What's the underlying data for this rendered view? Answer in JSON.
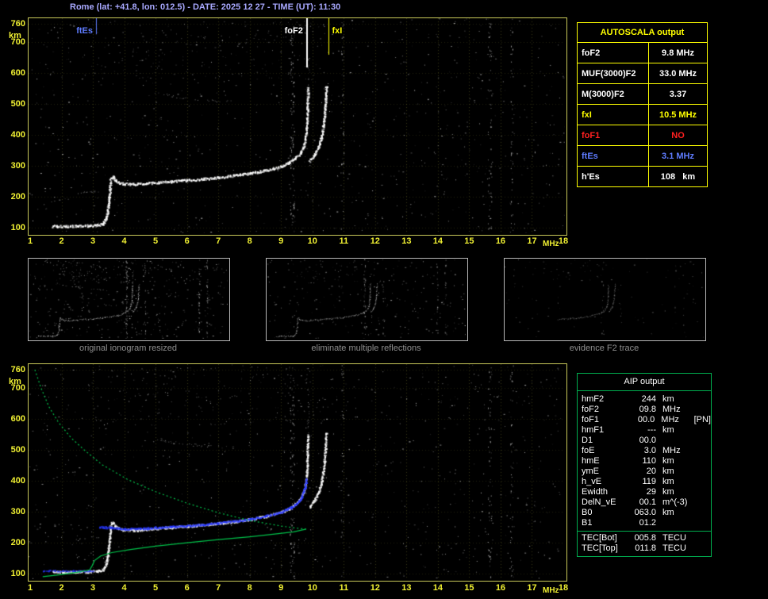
{
  "window": {
    "title": "Rome (lat: +41.8, lon: 012.5) - DATE: 2025 12 27 - TIME (UT): 11:30"
  },
  "autoscala": {
    "header": "AUTOSCALA output",
    "rows": [
      {
        "label": "foF2",
        "value": "9.8 MHz",
        "color": "#ffffff"
      },
      {
        "label": "MUF(3000)F2",
        "value": "33.0 MHz",
        "color": "#ffffff"
      },
      {
        "label": "M(3000)F2",
        "value": "3.37",
        "color": "#ffffff"
      },
      {
        "label": "fxI",
        "value": "10.5 MHz",
        "color": "#ffff00"
      },
      {
        "label": "foF1",
        "value": "NO",
        "color": "#ff2020"
      },
      {
        "label": "ftEs",
        "value": "3.1 MHz",
        "color": "#5f7cff"
      },
      {
        "label": "h'Es",
        "value": "108   km",
        "color": "#ffffff"
      }
    ]
  },
  "aip": {
    "header": "AIP output",
    "rows": [
      {
        "label": "hmF2",
        "value": "244",
        "unit": "km",
        "note": ""
      },
      {
        "label": "foF2",
        "value": "09.8",
        "unit": "MHz",
        "note": ""
      },
      {
        "label": "foF1",
        "value": "00.0",
        "unit": "MHz",
        "note": "[PN]"
      },
      {
        "label": "hmF1",
        "value": "---",
        "unit": "km",
        "note": ""
      },
      {
        "label": "D1",
        "value": "00.0",
        "unit": "",
        "note": ""
      },
      {
        "label": "foE",
        "value": "3.0",
        "unit": "MHz",
        "note": ""
      },
      {
        "label": "hmE",
        "value": "110",
        "unit": "km",
        "note": ""
      },
      {
        "label": "ymE",
        "value": "20",
        "unit": "km",
        "note": ""
      },
      {
        "label": "h_vE",
        "value": "119",
        "unit": "km",
        "note": ""
      },
      {
        "label": "Ewidth",
        "value": "29",
        "unit": "km",
        "note": ""
      },
      {
        "label": "DelN_vE",
        "value": "00.1",
        "unit": "m^(-3)",
        "note": ""
      },
      {
        "label": "B0",
        "value": "063.0",
        "unit": "km",
        "note": ""
      },
      {
        "label": "B1",
        "value": "01.2",
        "unit": "",
        "note": ""
      }
    ],
    "tec_rows": [
      {
        "label": "TEC[Bot]",
        "value": "005.8",
        "unit": "TECU",
        "note": ""
      },
      {
        "label": "TEC[Top]",
        "value": "011.8",
        "unit": "TECU",
        "note": ""
      }
    ]
  },
  "thumbnails": [
    {
      "caption": "original ionogram resized",
      "mode": "full"
    },
    {
      "caption": "eliminate multiple reflections",
      "mode": "clean"
    },
    {
      "caption": "evidence F2 trace",
      "mode": "f2"
    }
  ],
  "chart_data": [
    {
      "type": "scatter",
      "id": "ionogram-top",
      "title": "ionogram with autoscaled characteristics",
      "xlabel": "MHz",
      "ylabel": "km",
      "xlim": [
        1,
        18
      ],
      "ylim": [
        82,
        778
      ],
      "x_ticks": [
        1,
        2,
        3,
        4,
        5,
        6,
        7,
        8,
        9,
        10,
        11,
        12,
        13,
        14,
        15,
        16,
        17,
        18
      ],
      "y_ticks": [
        760,
        700,
        600,
        500,
        400,
        300,
        200,
        100
      ],
      "grid": "dotted",
      "markers": [
        {
          "label": "ftEs",
          "freq": 3.1,
          "color": "#5f7cff",
          "len": 20,
          "width": 1,
          "side": "left"
        },
        {
          "label": "foF2",
          "freq": 9.8,
          "color": "#ffffff",
          "len": 62,
          "width": 2,
          "side": "left"
        },
        {
          "label": "fxI",
          "freq": 10.5,
          "color": "#ffff00",
          "len": 46,
          "width": 1,
          "side": "right"
        }
      ],
      "series": [
        {
          "name": "Es-trace",
          "points": [
            [
              1.7,
              106
            ],
            [
              2.1,
              106
            ],
            [
              2.5,
              107
            ],
            [
              2.9,
              108
            ],
            [
              3.15,
              110
            ],
            [
              3.3,
              114
            ],
            [
              3.4,
              128
            ],
            [
              3.46,
              155
            ],
            [
              3.5,
              190
            ],
            [
              3.53,
              222
            ],
            [
              3.55,
              250
            ]
          ]
        },
        {
          "name": "Es-second-hop",
          "sparse": true,
          "points": [
            [
              2.4,
              214
            ],
            [
              2.7,
              216
            ],
            [
              3.0,
              217
            ],
            [
              3.2,
              219
            ]
          ]
        },
        {
          "name": "F-ordinary",
          "points": [
            [
              3.55,
              258
            ],
            [
              3.62,
              267
            ],
            [
              3.7,
              256
            ],
            [
              3.82,
              247
            ],
            [
              4.0,
              243
            ],
            [
              4.3,
              242
            ],
            [
              4.7,
              245
            ],
            [
              5.1,
              248
            ],
            [
              5.5,
              251
            ],
            [
              6.0,
              255
            ],
            [
              6.5,
              259
            ],
            [
              7.0,
              264
            ],
            [
              7.5,
              270
            ],
            [
              8.0,
              277
            ],
            [
              8.5,
              287
            ],
            [
              9.0,
              300
            ],
            [
              9.25,
              312
            ],
            [
              9.45,
              326
            ],
            [
              9.6,
              343
            ],
            [
              9.7,
              363
            ],
            [
              9.76,
              388
            ],
            [
              9.8,
              418
            ],
            [
              9.82,
              452
            ],
            [
              9.83,
              488
            ],
            [
              9.84,
              522
            ],
            [
              9.85,
              552
            ]
          ]
        },
        {
          "name": "F-extraordinary",
          "points": [
            [
              9.9,
              318
            ],
            [
              10.05,
              338
            ],
            [
              10.18,
              362
            ],
            [
              10.27,
              392
            ],
            [
              10.33,
              428
            ],
            [
              10.37,
              465
            ],
            [
              10.4,
              502
            ],
            [
              10.42,
              535
            ],
            [
              10.43,
              558
            ]
          ]
        },
        {
          "name": "multiples",
          "sparse": true,
          "points": [
            [
              4.9,
              540
            ],
            [
              5.2,
              533
            ],
            [
              5.5,
              527
            ],
            [
              5.9,
              521
            ],
            [
              6.3,
              516
            ],
            [
              6.7,
              513
            ],
            [
              7.1,
              511
            ],
            [
              7.5,
              511
            ]
          ]
        },
        {
          "name": "asymptote-top",
          "sparse": true,
          "points": [
            [
              9.85,
              560
            ],
            [
              9.86,
              595
            ],
            [
              9.87,
              625
            ],
            [
              9.88,
              655
            ]
          ]
        }
      ],
      "noise": {
        "seed": 20251227,
        "count": 780,
        "bands": [
          {
            "freq": 9.35,
            "width": 0.14,
            "count": 110
          },
          {
            "freq": 10.95,
            "width": 0.1,
            "count": 35
          },
          {
            "freq": 15.65,
            "width": 0.12,
            "count": 60
          },
          {
            "freq": 16.35,
            "width": 0.1,
            "count": 45
          }
        ],
        "top_cluster": {
          "count": 140,
          "frange": [
            3.0,
            10.2
          ],
          "krange": [
            580,
            770
          ]
        }
      }
    },
    {
      "type": "scatter",
      "id": "ionogram-bottom",
      "title": "ionogram with fitted trace and electron density profile",
      "xlabel": "MHz",
      "ylabel": "km",
      "profile": {
        "color": "#00c24a",
        "topside": [
          [
            1.15,
            760
          ],
          [
            1.35,
            700
          ],
          [
            1.6,
            640
          ],
          [
            1.9,
            590
          ],
          [
            2.3,
            540
          ],
          [
            2.75,
            498
          ],
          [
            3.3,
            452
          ],
          [
            4.1,
            405
          ],
          [
            5.0,
            365
          ],
          [
            6.0,
            328
          ],
          [
            7.0,
            297
          ],
          [
            8.0,
            272
          ],
          [
            9.0,
            254
          ],
          [
            9.5,
            247
          ],
          [
            9.8,
            244
          ]
        ],
        "bottomside": [
          [
            9.8,
            244
          ],
          [
            9.4,
            235
          ],
          [
            8.8,
            228
          ],
          [
            8.0,
            219
          ],
          [
            7.0,
            210
          ],
          [
            6.0,
            200
          ],
          [
            5.0,
            189
          ],
          [
            4.2,
            178
          ],
          [
            3.6,
            168
          ],
          [
            3.25,
            157
          ],
          [
            3.05,
            142
          ],
          [
            2.98,
            126
          ],
          [
            2.9,
            112
          ],
          [
            2.5,
            104
          ],
          [
            1.9,
            96
          ],
          [
            1.4,
            90
          ]
        ]
      },
      "fitted": {
        "color": "#2838ff",
        "f_trace": [
          [
            3.2,
            252
          ],
          [
            3.6,
            250
          ],
          [
            4.0,
            246
          ],
          [
            4.5,
            247
          ],
          [
            5.0,
            250
          ],
          [
            5.5,
            253
          ],
          [
            6.0,
            256
          ],
          [
            6.5,
            260
          ],
          [
            7.0,
            265
          ],
          [
            7.5,
            271
          ],
          [
            8.0,
            278
          ],
          [
            8.5,
            288
          ],
          [
            9.0,
            301
          ],
          [
            9.3,
            315
          ],
          [
            9.5,
            330
          ],
          [
            9.65,
            350
          ],
          [
            9.75,
            378
          ],
          [
            9.8,
            408
          ]
        ],
        "e_trace": [
          [
            1.4,
            111
          ],
          [
            2.0,
            110
          ],
          [
            2.6,
            110
          ],
          [
            3.0,
            110
          ]
        ]
      }
    }
  ]
}
